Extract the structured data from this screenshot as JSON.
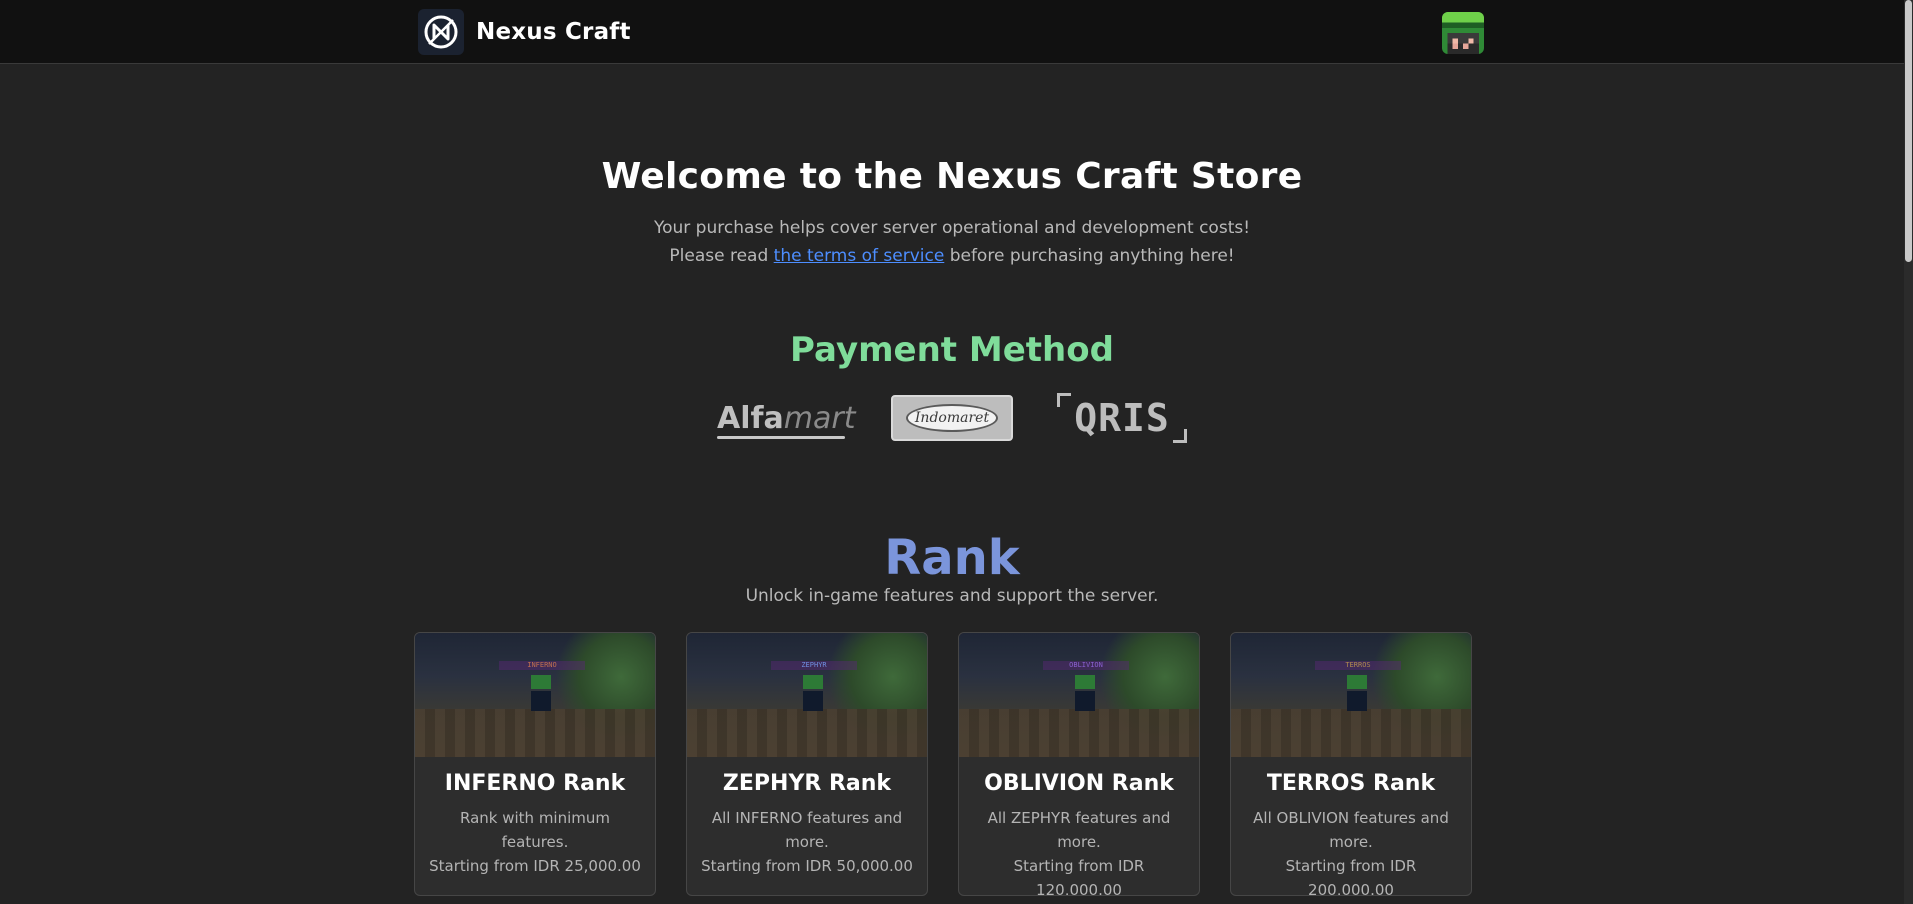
{
  "nav": {
    "brand_name": "Nexus Craft",
    "logo_icon": "nexus-craft-logo-icon",
    "avatar_icon": "player-avatar-icon"
  },
  "hero": {
    "title": "Welcome to the Nexus Craft Store",
    "line1": "Your purchase helps cover server operational and development costs!",
    "line2_before": "Please read ",
    "line2_link": "the terms of service",
    "line2_after": " before purchasing anything here!"
  },
  "payment": {
    "title": "Payment Method",
    "title_color": "#7fdc9a",
    "methods": [
      {
        "name": "Alfamart",
        "main": "Alfa",
        "sub": "mart"
      },
      {
        "name": "Indomaret",
        "label": "Indomaret"
      },
      {
        "name": "QRIS",
        "label": "QRIS"
      }
    ]
  },
  "rank": {
    "title": "Rank",
    "title_color": "#7b95db",
    "subtitle": "Unlock in-game features and support the server.",
    "cards": [
      {
        "title": "INFERNO Rank",
        "desc": "Rank with minimum features.",
        "price": "Starting from IDR 25,000.00",
        "tag": "INFERNO"
      },
      {
        "title": "ZEPHYR Rank",
        "desc": "All INFERNO features and more.",
        "price": "Starting from IDR 50,000.00",
        "tag": "ZEPHYR"
      },
      {
        "title": "OBLIVION Rank",
        "desc": "All ZEPHYR features and more.",
        "price": "Starting from IDR 120,000.00",
        "tag": "OBLIVION"
      },
      {
        "title": "TERROS Rank",
        "desc": "All OBLIVION features and more.",
        "price": "Starting from IDR 200,000.00",
        "tag": "TERROS"
      }
    ]
  },
  "colors": {
    "background": "#232323",
    "navbar": "#111111",
    "link": "#4d8eff"
  }
}
